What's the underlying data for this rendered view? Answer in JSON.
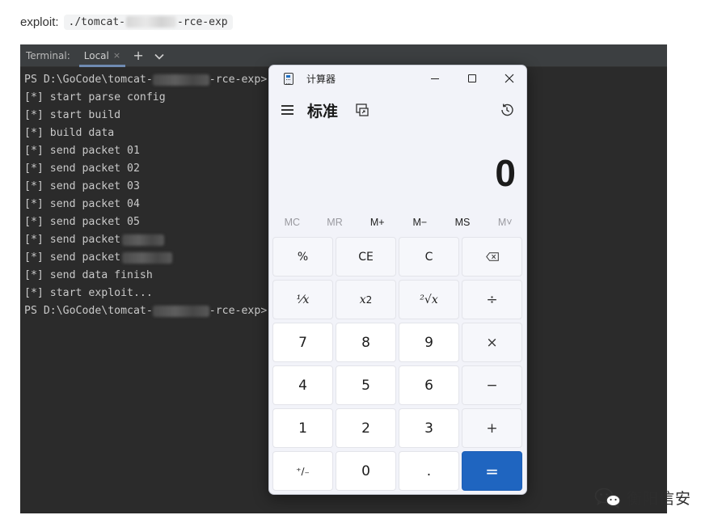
{
  "article": {
    "exploit_label": "exploit:",
    "exploit_cmd_prefix": "./tomcat-",
    "exploit_cmd_suffix": "-rce-exp"
  },
  "terminal": {
    "title": "Terminal:",
    "tab_label": "Local",
    "close_glyph": "×",
    "add_glyph": "+",
    "dropdown_glyph": "⌄",
    "prompt_prefix": "PS D:\\GoCode\\tomcat-",
    "prompt_suffix": "-rce-exp>",
    "lines": [
      "[*] start parse config",
      "[*] start build",
      "[*] build data",
      "[*] send packet 01",
      "[*] send packet 02",
      "[*] send packet 03",
      "[*] send packet 04",
      "[*] send packet 05"
    ],
    "packet_prefix": "[*] send packet",
    "finish_line": "[*] send data finish",
    "exploit_line": "[*] start exploit..."
  },
  "calculator": {
    "window_title": "计算器",
    "mode_title": "标准",
    "display_value": "0",
    "memory_buttons": [
      "MC",
      "MR",
      "M+",
      "M−",
      "MS",
      "M˅"
    ],
    "keys": {
      "percent": "%",
      "ce": "CE",
      "c": "C",
      "backspace": "⌫",
      "reciprocal": "⅟x",
      "square_base": "x",
      "square_exp": "2",
      "sqrt": "²√x",
      "divide": "÷",
      "seven": "7",
      "eight": "8",
      "nine": "9",
      "multiply": "×",
      "four": "4",
      "five": "5",
      "six": "6",
      "minus": "−",
      "one": "1",
      "two": "2",
      "three": "3",
      "plus": "+",
      "negate": "⁺∕₋",
      "zero": "0",
      "decimal": ".",
      "equals": "="
    },
    "colors": {
      "equals_bg": "#1f65c0",
      "window_bg": "#f2f3f9"
    }
  },
  "watermark": {
    "text": "衡阳信安"
  }
}
